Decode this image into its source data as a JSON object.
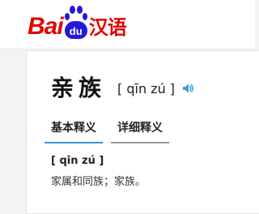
{
  "logo": {
    "bai_b": "B",
    "bai_ai": "ai",
    "du": "du",
    "hanyu": "汉语"
  },
  "entry": {
    "word": "亲族",
    "pinyin": "[ qīn zú ]",
    "speaker_icon": "speaker-icon"
  },
  "tabs": [
    {
      "label": "基本释义",
      "active": true
    },
    {
      "label": "详细释义",
      "active": false
    }
  ],
  "definition": {
    "pinyin": "[ qīn zú ]",
    "text": "家属和同族；家族。"
  },
  "colors": {
    "brand_red": "#e10601",
    "brand_blue": "#2319dc",
    "active_tab": "#3d8fe5",
    "speaker": "#3ba0e6"
  }
}
